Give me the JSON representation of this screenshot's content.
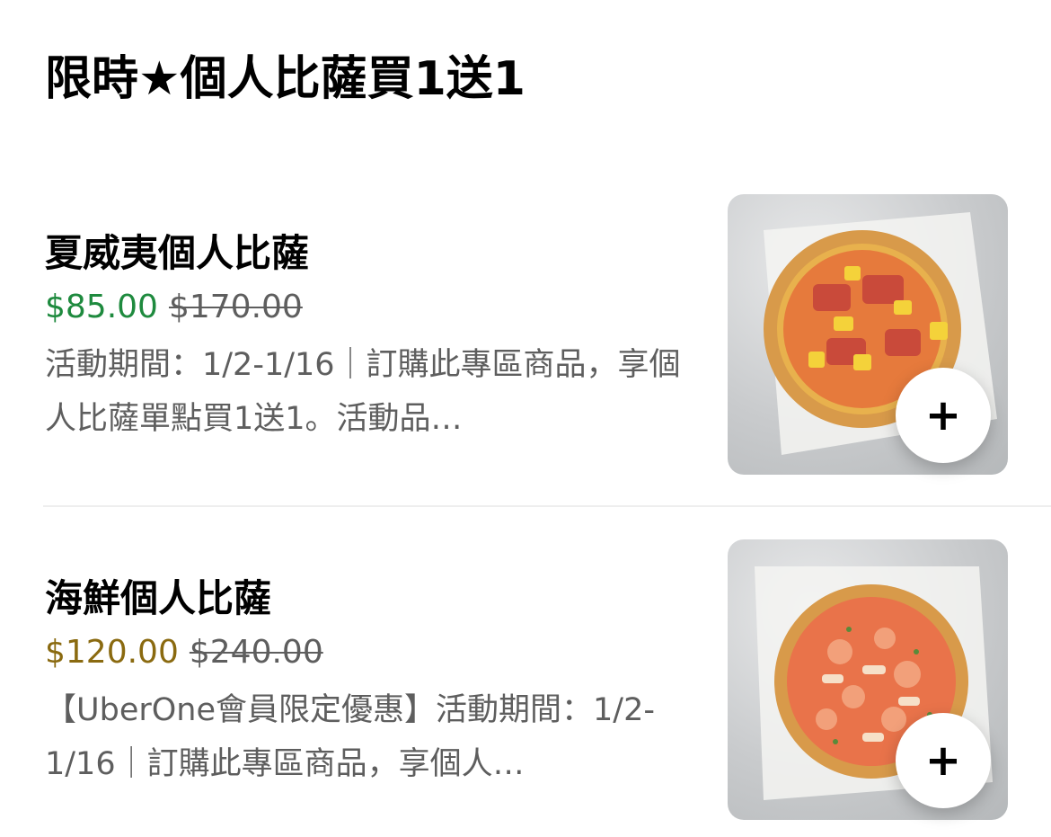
{
  "section": {
    "title": "限時★個人比薩買1送1"
  },
  "items": [
    {
      "name": "夏威夷個人比薩",
      "price": "$85.00",
      "original_price": "$170.00",
      "description": "活動期間：1/2-1/16｜訂購此專區商品，享個人比薩單點買1送1。活動品…",
      "add_icon": "plus-icon",
      "add_label": "+"
    },
    {
      "name": "海鮮個人比薩",
      "price": "$120.00",
      "original_price": "$240.00",
      "description": "【UberOne會員限定優惠】活動期間：1/2-1/16｜訂購此專區商品，享個人…",
      "add_icon": "plus-icon",
      "add_label": "+"
    }
  ],
  "colors": {
    "price_green": "#1e8a3e",
    "price_gold": "#8a6a10",
    "secondary_text": "#5e5e5e",
    "divider": "#eeeeee"
  }
}
